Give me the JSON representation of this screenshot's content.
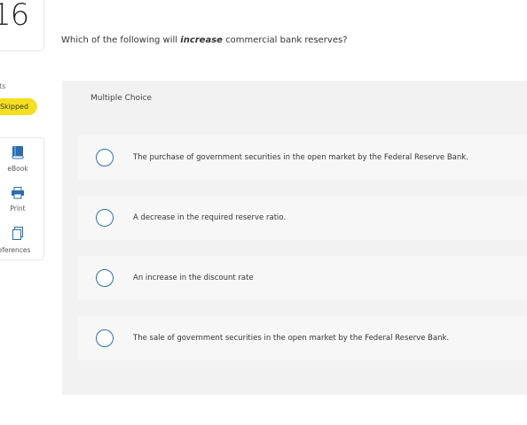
{
  "question_number": "16",
  "sidebar": {
    "points_label": "nts",
    "status_badge": "Skipped",
    "tools": [
      {
        "label": "eBook",
        "icon": "book-icon"
      },
      {
        "label": "Print",
        "icon": "printer-icon"
      },
      {
        "label": "eferences",
        "icon": "references-icon"
      }
    ]
  },
  "question": {
    "prefix": "Which of the following will ",
    "emphasis": "increase",
    "suffix": " commercial bank reserves?"
  },
  "answer_panel": {
    "type_label": "Multiple Choice",
    "options": [
      {
        "text": "The purchase of government securities in the open market by the Federal Reserve Bank."
      },
      {
        "text": "A decrease in the required reserve ratio."
      },
      {
        "text": "An increase in the discount rate"
      },
      {
        "text": "The sale of government securities in the open market by the Federal Reserve Bank."
      }
    ]
  },
  "colors": {
    "badge": "#f5df1f",
    "radio_border": "#2f6fb3",
    "panel_bg": "#f2f2f2",
    "icon_blue": "#2a6cb0"
  }
}
